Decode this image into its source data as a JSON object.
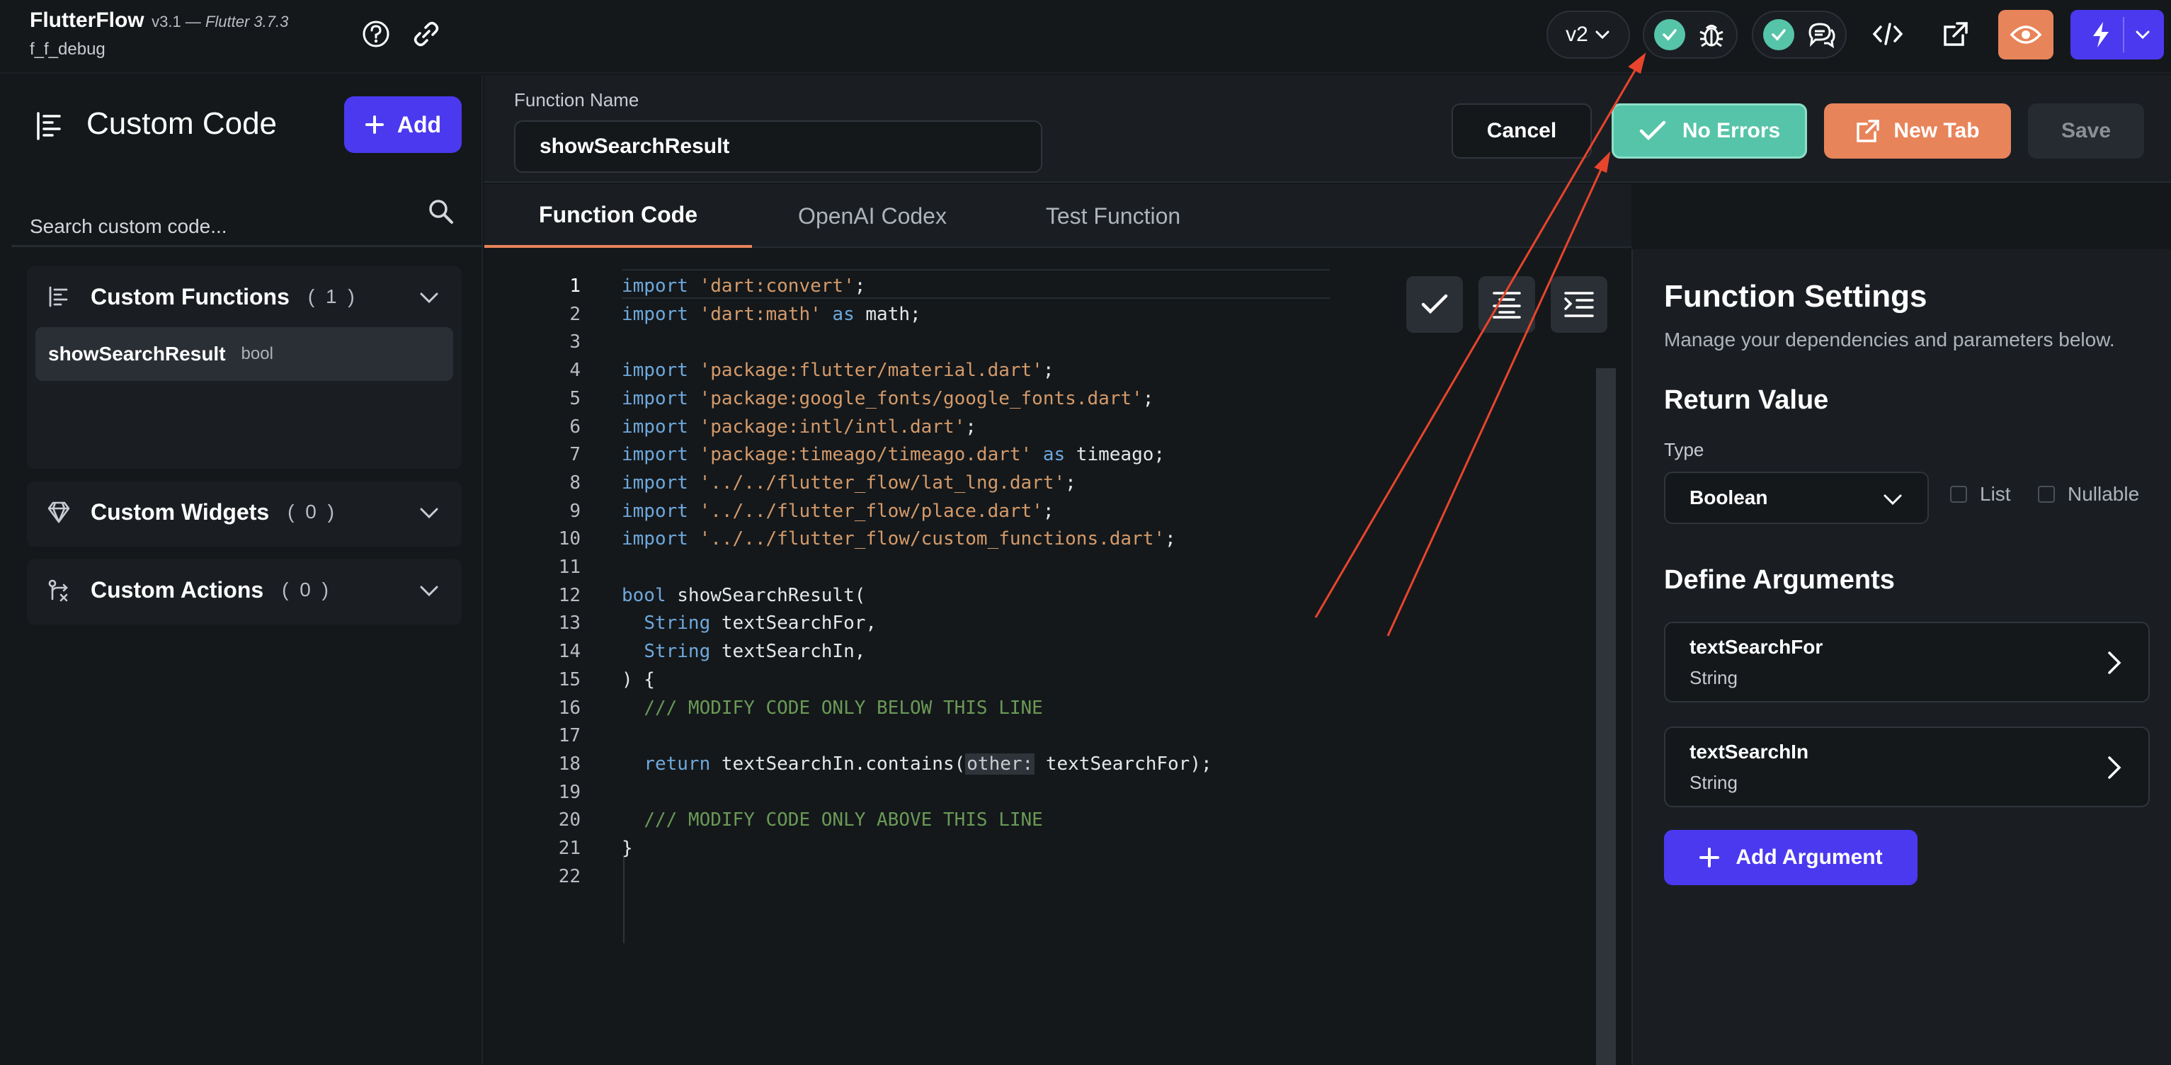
{
  "app": {
    "name": "FlutterFlow",
    "version": "v3.1 —",
    "flutter_version": "Flutter 3.7.3",
    "project": "f_f_debug"
  },
  "topbar": {
    "version_selector": "v2"
  },
  "sidebar": {
    "title": "Custom Code",
    "add_label": "Add",
    "search_placeholder": "Search custom code...",
    "sections": [
      {
        "title": "Custom Functions",
        "count": "( 1 )",
        "items": [
          {
            "name": "showSearchResult",
            "type": "bool"
          }
        ]
      },
      {
        "title": "Custom Widgets",
        "count": "( 0 )"
      },
      {
        "title": "Custom Actions",
        "count": "( 0 )"
      }
    ]
  },
  "header": {
    "function_name_label": "Function Name",
    "function_name_value": "showSearchResult",
    "cancel_label": "Cancel",
    "no_errors_label": "No Errors",
    "new_tab_label": "New Tab",
    "save_label": "Save"
  },
  "tabs": [
    "Function Code",
    "OpenAI Codex",
    "Test Function"
  ],
  "editor": {
    "line_numbers": [
      "1",
      "2",
      "3",
      "4",
      "5",
      "6",
      "7",
      "8",
      "9",
      "10",
      "11",
      "12",
      "13",
      "14",
      "15",
      "16",
      "17",
      "18",
      "19",
      "20",
      "21",
      "22"
    ],
    "lines": [
      {
        "kw1": "import",
        "str": "'dart:convert'",
        "rest": ";"
      },
      {
        "kw1": "import",
        "str": "'dart:math'",
        "kw2": "as",
        "rest": " math;"
      },
      {},
      {
        "kw1": "import",
        "str": "'package:flutter/material.dart'",
        "rest": ";"
      },
      {
        "kw1": "import",
        "str": "'package:google_fonts/google_fonts.dart'",
        "rest": ";"
      },
      {
        "kw1": "import",
        "str": "'package:intl/intl.dart'",
        "rest": ";"
      },
      {
        "kw1": "import",
        "str": "'package:timeago/timeago.dart'",
        "kw2": "as",
        "rest": " timeago;"
      },
      {
        "kw1": "import",
        "str": "'../../flutter_flow/lat_lng.dart'",
        "rest": ";"
      },
      {
        "kw1": "import",
        "str": "'../../flutter_flow/place.dart'",
        "rest": ";"
      },
      {
        "kw1": "import",
        "str": "'../../flutter_flow/custom_functions.dart'",
        "rest": ";"
      },
      {},
      {
        "kw1": "bool",
        "rest": " showSearchResult("
      },
      {
        "indent": "  ",
        "kw1": "String",
        "rest": " textSearchFor,"
      },
      {
        "indent": "  ",
        "kw1": "String",
        "rest": " textSearchIn,"
      },
      {
        "rest": ") {"
      },
      {
        "indent": "  ",
        "cmt": "/// MODIFY CODE ONLY BELOW THIS LINE"
      },
      {},
      {
        "indent": "  ",
        "kw1": "return",
        "rest": " textSearchIn.contains(",
        "hint": "other:",
        "rest2": " textSearchFor);"
      },
      {},
      {
        "indent": "  ",
        "cmt": "/// MODIFY CODE ONLY ABOVE THIS LINE"
      },
      {
        "rest": "}"
      },
      {}
    ]
  },
  "settings": {
    "title": "Function Settings",
    "subtitle": "Manage your dependencies and parameters below.",
    "return_value_heading": "Return Value",
    "type_label": "Type",
    "type_value": "Boolean",
    "list_label": "List",
    "nullable_label": "Nullable",
    "define_arguments_heading": "Define Arguments",
    "arguments": [
      {
        "name": "textSearchFor",
        "type": "String"
      },
      {
        "name": "textSearchIn",
        "type": "String"
      }
    ],
    "add_argument_label": "Add Argument"
  },
  "colors": {
    "accent_blue": "#4b39ef",
    "success_green": "#56c4a8",
    "orange": "#e8845a",
    "annotation_red": "#e8452c"
  }
}
